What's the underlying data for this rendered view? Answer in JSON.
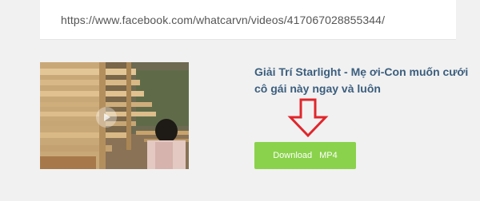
{
  "url_field": {
    "value": "https://www.facebook.com/whatcarvn/videos/417067028855344/"
  },
  "video": {
    "title": "Giải Trí Starlight - Mẹ ơi-Con muốn cưới cô gái này ngay và luôn"
  },
  "download": {
    "label": "Download",
    "format": "MP4"
  },
  "colors": {
    "title": "#3b5e7e",
    "button": "#8ad24b",
    "arrow": "#e0262b"
  },
  "icons": {
    "thumbnail_play": "play-icon",
    "pointer": "arrow-down-icon"
  }
}
